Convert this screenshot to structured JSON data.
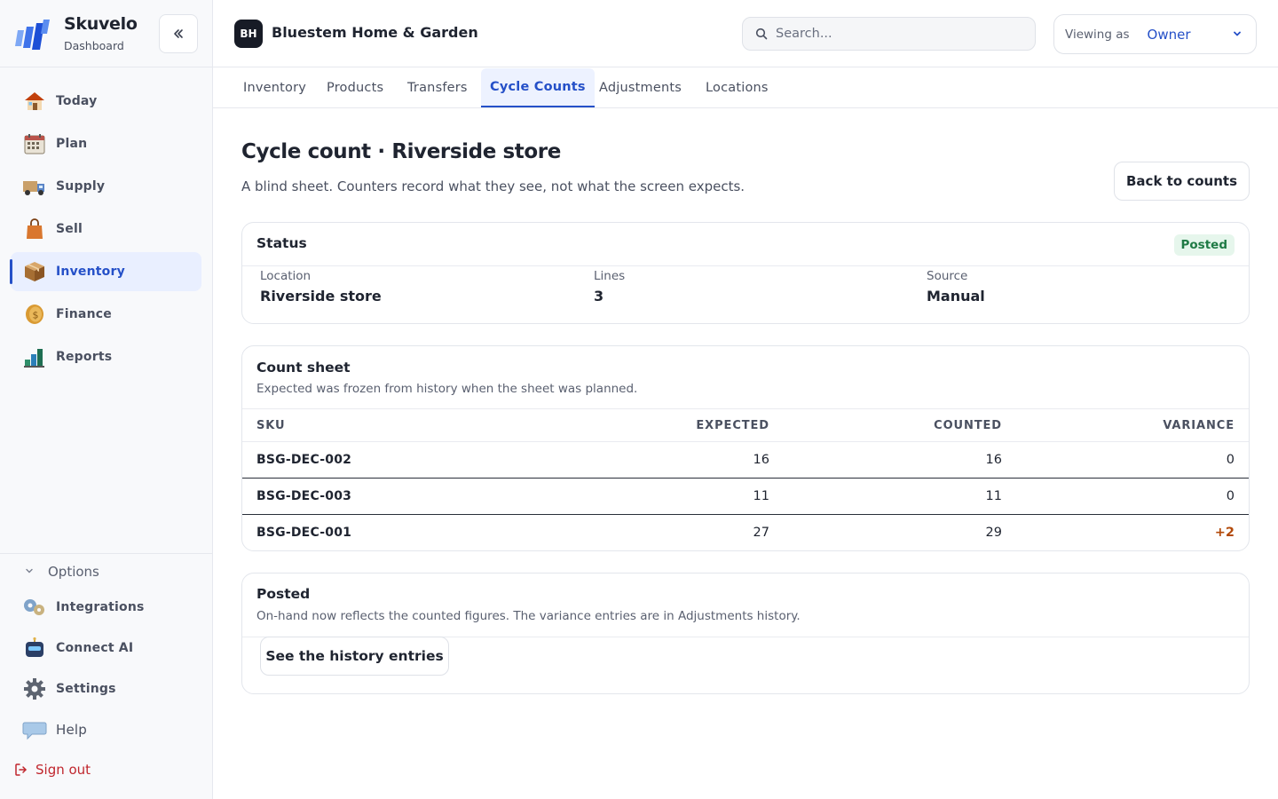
{
  "brand": {
    "name": "Skuvelo",
    "subtitle": "Dashboard"
  },
  "sidebar": {
    "items": [
      {
        "label": "Today",
        "icon": "house-icon"
      },
      {
        "label": "Plan",
        "icon": "calendar-icon"
      },
      {
        "label": "Supply",
        "icon": "truck-icon"
      },
      {
        "label": "Sell",
        "icon": "shopping-bag-icon"
      },
      {
        "label": "Inventory",
        "icon": "package-icon",
        "active": true
      },
      {
        "label": "Finance",
        "icon": "coin-icon"
      },
      {
        "label": "Reports",
        "icon": "bar-chart-icon"
      }
    ],
    "options_label": "Options",
    "options_items": [
      {
        "label": "Integrations",
        "icon": "puzzle-gears-icon"
      },
      {
        "label": "Connect AI",
        "icon": "robot-icon"
      },
      {
        "label": "Settings",
        "icon": "gear-icon"
      },
      {
        "label": "Help",
        "icon": "speech-bubble-icon"
      }
    ],
    "signout_label": "Sign out"
  },
  "topbar": {
    "org_initials": "BH",
    "org_name": "Bluestem Home & Garden",
    "search_placeholder": "Search...",
    "viewing_label": "Viewing as",
    "viewing_value": "Owner"
  },
  "tabs": [
    {
      "label": "Inventory"
    },
    {
      "label": "Products"
    },
    {
      "label": "Transfers"
    },
    {
      "label": "Cycle Counts",
      "active": true
    },
    {
      "label": "Adjustments"
    },
    {
      "label": "Locations"
    }
  ],
  "page": {
    "title": "Cycle count · Riverside store",
    "subtitle": "A blind sheet. Counters record what they see, not what the screen expects.",
    "back_button": "Back to counts"
  },
  "status_card": {
    "title": "Status",
    "badge": "Posted",
    "meta": [
      {
        "label": "Location",
        "value": "Riverside store"
      },
      {
        "label": "Lines",
        "value": "3"
      },
      {
        "label": "Source",
        "value": "Manual"
      }
    ]
  },
  "count_sheet": {
    "title": "Count sheet",
    "description": "Expected was frozen from history when the sheet was planned.",
    "columns": [
      "SKU",
      "EXPECTED",
      "COUNTED",
      "VARIANCE"
    ],
    "rows": [
      {
        "sku": "BSG-DEC-002",
        "expected": "16",
        "counted": "16",
        "variance": "0"
      },
      {
        "sku": "BSG-DEC-003",
        "expected": "11",
        "counted": "11",
        "variance": "0"
      },
      {
        "sku": "BSG-DEC-001",
        "expected": "27",
        "counted": "29",
        "variance": "+2"
      }
    ]
  },
  "posted_card": {
    "title": "Posted",
    "description": "On-hand now reflects the counted figures. The variance entries are in Adjustments history.",
    "button": "See the history entries"
  },
  "colors": {
    "accent": "#2550c8",
    "posted_badge_bg": "#e6f6ec",
    "posted_badge_text": "#1f7a45",
    "variance_positive": "#b34a0a",
    "signout": "#c0262d"
  }
}
